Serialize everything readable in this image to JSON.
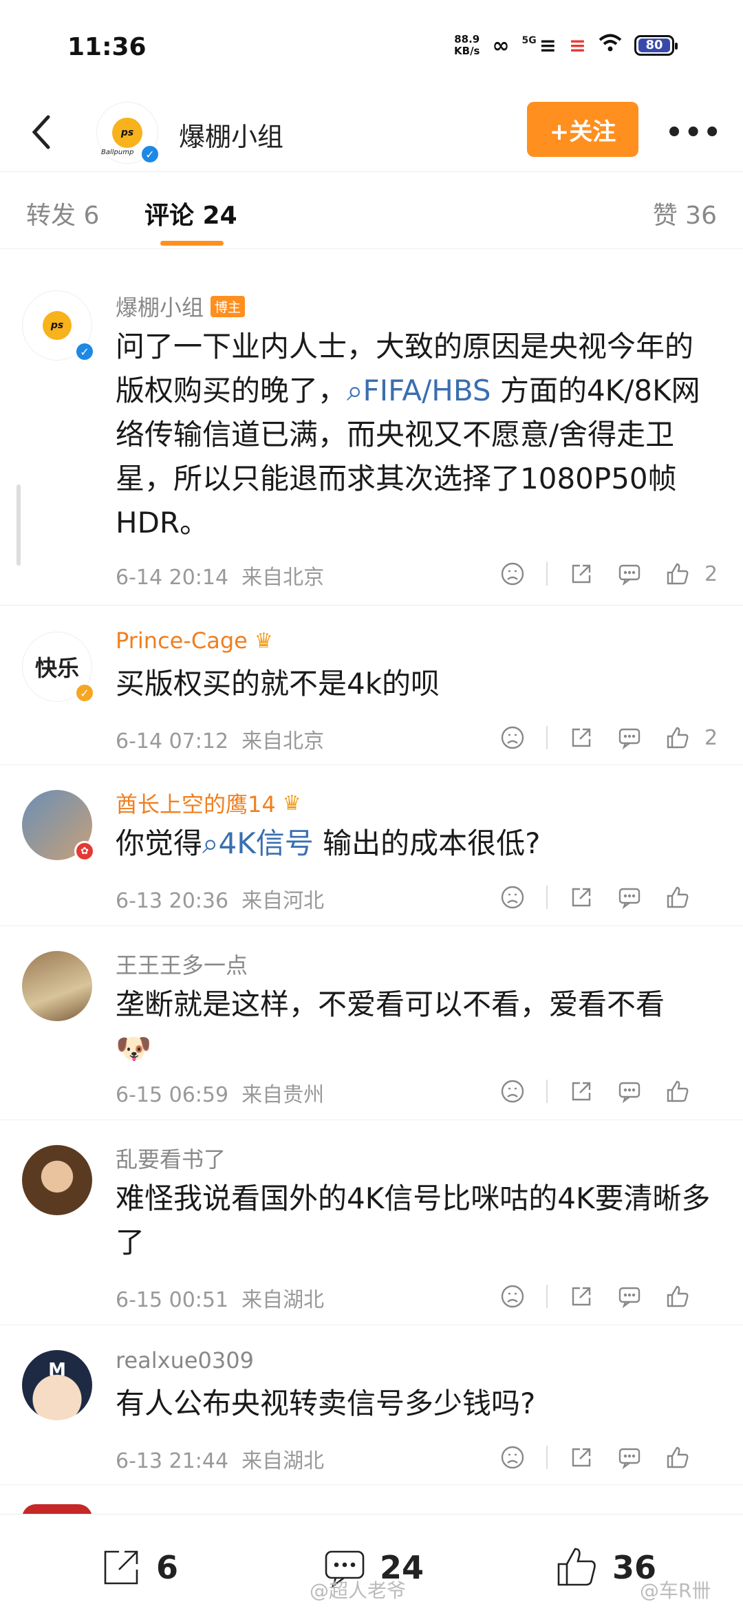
{
  "status_bar": {
    "time": "11:36",
    "net_speed_value": "88.9",
    "net_speed_unit": "KB/s",
    "signal_label": "5G",
    "battery": "80"
  },
  "header": {
    "title": "爆棚小组",
    "follow_label": "+关注",
    "more_label": "•••",
    "avatar_logo_text": "ps",
    "avatar_logo_caption": "Ballpump"
  },
  "tabs": [
    {
      "label": "转发 6"
    },
    {
      "label": "评论 24"
    },
    {
      "label": "赞 36"
    }
  ],
  "comments": [
    {
      "user": "爆棚小组",
      "badge": "博主",
      "text_parts": [
        "问了一下业内人士，大致的原因是央视今年的版权购买的晚了，",
        "FIFA/HBS",
        " 方面的4K/8K网络传输信道已满，而央视又不愿意/舍得走卫星，所以只能退而求其次选择了1080P50帧HDR。"
      ],
      "time": "6-14 20:14",
      "location": "来自北京",
      "likes": "2"
    },
    {
      "user": "Prince-Cage",
      "avatar_text": "快乐",
      "text": "买版权买的就不是4k的呗",
      "time": "6-14 07:12",
      "location": "来自北京",
      "likes": "2"
    },
    {
      "user": "酋长上空的鹰14",
      "text_parts": [
        "你觉得",
        "4K信号",
        " 输出的成本很低?"
      ],
      "time": "6-13 20:36",
      "location": "来自河北",
      "likes": ""
    },
    {
      "user": "王王王多一点",
      "text": "垄断就是这样，不爱看可以不看，爱看不看",
      "time": "6-15 06:59",
      "location": "来自贵州",
      "likes": ""
    },
    {
      "user": "乱要看书了",
      "text": "难怪我说看国外的4K信号比咪咕的4K要清晰多了",
      "time": "6-15 00:51",
      "location": "来自湖北",
      "likes": ""
    },
    {
      "user": "realxue0309",
      "avatar_text": "M",
      "text": "有人公布央视转卖信号多少钱吗?",
      "time": "6-13 21:44",
      "location": "来自湖北",
      "likes": ""
    }
  ],
  "bottom_bar": {
    "repost_count": "6",
    "comment_count": "24",
    "like_count": "36"
  },
  "watermarks": [
    "@超人老爷",
    "@车R卌"
  ],
  "colors": {
    "accent": "#ff8f1f",
    "link": "#3a6fb0",
    "verified": "#1e88e5"
  }
}
